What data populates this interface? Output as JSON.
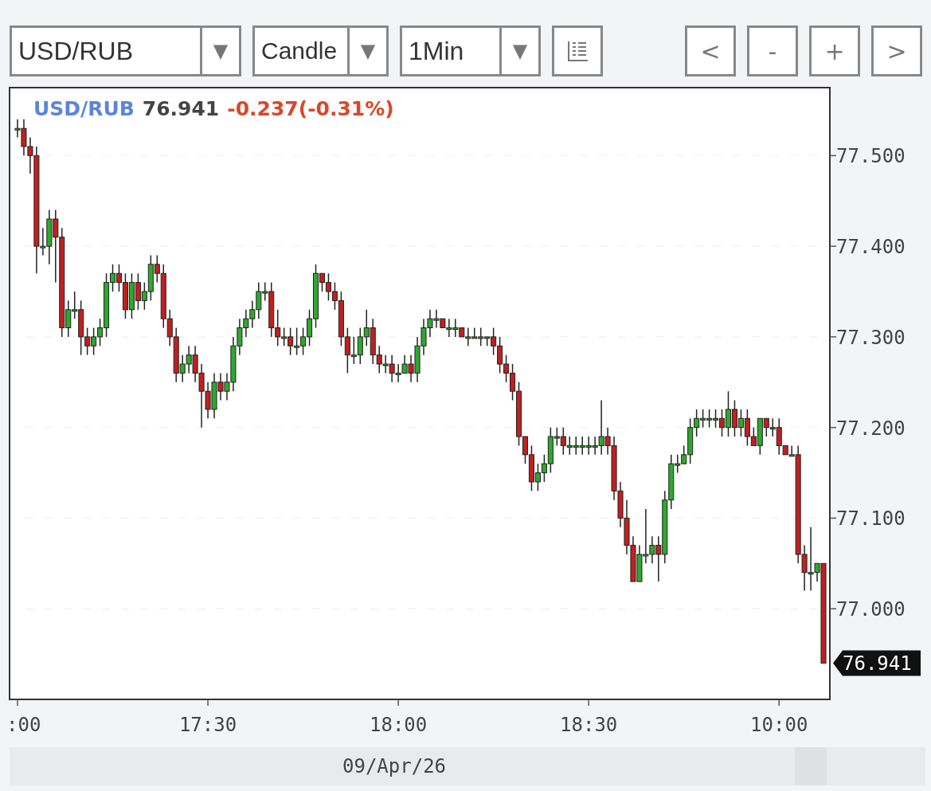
{
  "toolbar": {
    "dropdowns": [
      {
        "value": "USD/RUB",
        "arrow": "▼"
      },
      {
        "value": "Candle",
        "arrow": "▼"
      },
      {
        "value": "1Min",
        "arrow": "▼"
      }
    ],
    "nav_buttons": [
      "<",
      "-",
      "+",
      ">"
    ]
  },
  "legend": {
    "symbol": "USD/RUB",
    "price": "76.941",
    "change": "-0.237(-0.31%)"
  },
  "chart": {
    "chart_data": {
      "type": "candlestick",
      "xlabel": "09/Apr/26",
      "ylim": [
        76.9,
        77.575
      ],
      "grid": true,
      "categories": [
        ":00",
        null,
        null,
        null,
        null,
        null,
        null,
        null,
        null,
        null,
        null,
        null,
        null,
        null,
        null,
        null,
        null,
        null,
        null,
        null,
        null,
        null,
        null,
        null,
        null,
        null,
        null,
        null,
        null,
        null,
        "17:30",
        null,
        null,
        null,
        null,
        null,
        null,
        null,
        null,
        null,
        null,
        null,
        null,
        null,
        null,
        null,
        null,
        null,
        null,
        null,
        null,
        null,
        null,
        null,
        null,
        null,
        null,
        null,
        null,
        null,
        "18:00",
        null,
        null,
        null,
        null,
        null,
        null,
        null,
        null,
        null,
        null,
        null,
        null,
        null,
        null,
        null,
        null,
        null,
        null,
        null,
        null,
        null,
        null,
        null,
        null,
        null,
        null,
        null,
        null,
        null,
        "18:30",
        null,
        null,
        null,
        null,
        null,
        null,
        null,
        null,
        null,
        null,
        null,
        null,
        null,
        null,
        null,
        null,
        null,
        null,
        null,
        null,
        null,
        null,
        null,
        null,
        null,
        null,
        null,
        null,
        null,
        "10:00",
        null,
        null,
        null,
        null,
        null,
        null,
        null
      ],
      "yticks": [
        {
          "value": 77.0,
          "label": "77.000"
        },
        {
          "value": 77.1,
          "label": "77.100"
        },
        {
          "value": 77.2,
          "label": "77.200"
        },
        {
          "value": 77.3,
          "label": "77.300"
        },
        {
          "value": 77.4,
          "label": "77.400"
        },
        {
          "value": 77.5,
          "label": "77.500"
        }
      ],
      "annotations": [
        "76.941"
      ],
      "ohlc": [
        [
          77.53,
          77.54,
          77.52,
          77.53
        ],
        [
          77.53,
          77.54,
          77.5,
          77.51
        ],
        [
          77.51,
          77.52,
          77.48,
          77.5
        ],
        [
          77.5,
          77.51,
          77.37,
          77.4
        ],
        [
          77.4,
          77.42,
          77.39,
          77.4
        ],
        [
          77.4,
          77.44,
          77.38,
          77.43
        ],
        [
          77.43,
          77.44,
          77.36,
          77.41
        ],
        [
          77.41,
          77.42,
          77.3,
          77.31
        ],
        [
          77.31,
          77.34,
          77.3,
          77.33
        ],
        [
          77.33,
          77.35,
          77.32,
          77.33
        ],
        [
          77.33,
          77.34,
          77.28,
          77.3
        ],
        [
          77.3,
          77.31,
          77.28,
          77.29
        ],
        [
          77.29,
          77.31,
          77.28,
          77.3
        ],
        [
          77.3,
          77.32,
          77.29,
          77.31
        ],
        [
          77.31,
          77.37,
          77.3,
          77.36
        ],
        [
          77.36,
          77.38,
          77.35,
          77.37
        ],
        [
          77.37,
          77.38,
          77.35,
          77.36
        ],
        [
          77.36,
          77.37,
          77.32,
          77.33
        ],
        [
          77.33,
          77.37,
          77.32,
          77.36
        ],
        [
          77.36,
          77.37,
          77.33,
          77.34
        ],
        [
          77.34,
          77.36,
          77.33,
          77.35
        ],
        [
          77.35,
          77.39,
          77.34,
          77.38
        ],
        [
          77.38,
          77.39,
          77.36,
          77.37
        ],
        [
          77.37,
          77.38,
          77.31,
          77.32
        ],
        [
          77.32,
          77.33,
          77.29,
          77.3
        ],
        [
          77.3,
          77.31,
          77.25,
          77.26
        ],
        [
          77.26,
          77.28,
          77.25,
          77.27
        ],
        [
          77.27,
          77.29,
          77.26,
          77.28
        ],
        [
          77.28,
          77.29,
          77.25,
          77.26
        ],
        [
          77.26,
          77.27,
          77.2,
          77.24
        ],
        [
          77.24,
          77.25,
          77.21,
          77.22
        ],
        [
          77.22,
          77.26,
          77.21,
          77.25
        ],
        [
          77.25,
          77.26,
          77.23,
          77.24
        ],
        [
          77.24,
          77.26,
          77.23,
          77.25
        ],
        [
          77.25,
          77.3,
          77.24,
          77.29
        ],
        [
          77.29,
          77.32,
          77.28,
          77.31
        ],
        [
          77.31,
          77.33,
          77.3,
          77.32
        ],
        [
          77.32,
          77.34,
          77.31,
          77.33
        ],
        [
          77.33,
          77.36,
          77.32,
          77.35
        ],
        [
          77.35,
          77.36,
          77.34,
          77.35
        ],
        [
          77.35,
          77.36,
          77.3,
          77.31
        ],
        [
          77.31,
          77.33,
          77.29,
          77.3
        ],
        [
          77.3,
          77.31,
          77.29,
          77.3
        ],
        [
          77.3,
          77.31,
          77.28,
          77.29
        ],
        [
          77.29,
          77.31,
          77.28,
          77.29
        ],
        [
          77.29,
          77.31,
          77.28,
          77.3
        ],
        [
          77.3,
          77.33,
          77.29,
          77.32
        ],
        [
          77.32,
          77.38,
          77.31,
          77.37
        ],
        [
          77.37,
          77.37,
          77.35,
          77.36
        ],
        [
          77.36,
          77.37,
          77.34,
          77.35
        ],
        [
          77.35,
          77.36,
          77.33,
          77.34
        ],
        [
          77.34,
          77.35,
          77.29,
          77.3
        ],
        [
          77.3,
          77.31,
          77.26,
          77.28
        ],
        [
          77.28,
          77.3,
          77.27,
          77.28
        ],
        [
          77.28,
          77.31,
          77.27,
          77.3
        ],
        [
          77.3,
          77.33,
          77.29,
          77.31
        ],
        [
          77.31,
          77.32,
          77.27,
          77.28
        ],
        [
          77.28,
          77.29,
          77.26,
          77.27
        ],
        [
          77.27,
          77.28,
          77.26,
          77.27
        ],
        [
          77.27,
          77.28,
          77.25,
          77.26
        ],
        [
          77.26,
          77.27,
          77.25,
          77.26
        ],
        [
          77.26,
          77.28,
          77.26,
          77.27
        ],
        [
          77.27,
          77.28,
          77.25,
          77.26
        ],
        [
          77.26,
          77.3,
          77.25,
          77.29
        ],
        [
          77.29,
          77.32,
          77.28,
          77.31
        ],
        [
          77.31,
          77.33,
          77.3,
          77.32
        ],
        [
          77.32,
          77.33,
          77.31,
          77.32
        ],
        [
          77.32,
          77.32,
          77.31,
          77.31
        ],
        [
          77.31,
          77.32,
          77.3,
          77.31
        ],
        [
          77.31,
          77.32,
          77.3,
          77.31
        ],
        [
          77.31,
          77.31,
          77.3,
          77.3
        ],
        [
          77.3,
          77.31,
          77.29,
          77.3
        ],
        [
          77.3,
          77.31,
          77.3,
          77.3
        ],
        [
          77.3,
          77.31,
          77.29,
          77.3
        ],
        [
          77.3,
          77.3,
          77.29,
          77.3
        ],
        [
          77.3,
          77.31,
          77.28,
          77.29
        ],
        [
          77.29,
          77.3,
          77.26,
          77.27
        ],
        [
          77.27,
          77.28,
          77.25,
          77.26
        ],
        [
          77.26,
          77.27,
          77.23,
          77.24
        ],
        [
          77.24,
          77.25,
          77.18,
          77.19
        ],
        [
          77.19,
          77.19,
          77.16,
          77.17
        ],
        [
          77.17,
          77.18,
          77.13,
          77.14
        ],
        [
          77.14,
          77.16,
          77.13,
          77.15
        ],
        [
          77.15,
          77.17,
          77.14,
          77.16
        ],
        [
          77.16,
          77.2,
          77.15,
          77.19
        ],
        [
          77.19,
          77.2,
          77.18,
          77.19
        ],
        [
          77.19,
          77.2,
          77.17,
          77.18
        ],
        [
          77.18,
          77.19,
          77.17,
          77.18
        ],
        [
          77.18,
          77.19,
          77.17,
          77.18
        ],
        [
          77.18,
          77.19,
          77.17,
          77.18
        ],
        [
          77.18,
          77.19,
          77.17,
          77.18
        ],
        [
          77.18,
          77.19,
          77.17,
          77.18
        ],
        [
          77.18,
          77.23,
          77.17,
          77.19
        ],
        [
          77.19,
          77.2,
          77.17,
          77.18
        ],
        [
          77.18,
          77.19,
          77.12,
          77.13
        ],
        [
          77.13,
          77.14,
          77.09,
          77.1
        ],
        [
          77.1,
          77.12,
          77.06,
          77.07
        ],
        [
          77.07,
          77.08,
          77.03,
          77.03
        ],
        [
          77.03,
          77.07,
          77.03,
          77.06
        ],
        [
          77.06,
          77.11,
          77.05,
          77.06
        ],
        [
          77.06,
          77.08,
          77.05,
          77.07
        ],
        [
          77.07,
          77.08,
          77.03,
          77.06
        ],
        [
          77.06,
          77.13,
          77.05,
          77.12
        ],
        [
          77.12,
          77.17,
          77.11,
          77.16
        ],
        [
          77.16,
          77.17,
          77.15,
          77.16
        ],
        [
          77.16,
          77.18,
          77.16,
          77.17
        ],
        [
          77.17,
          77.21,
          77.16,
          77.2
        ],
        [
          77.2,
          77.22,
          77.19,
          77.21
        ],
        [
          77.21,
          77.22,
          77.2,
          77.21
        ],
        [
          77.21,
          77.22,
          77.2,
          77.21
        ],
        [
          77.21,
          77.22,
          77.2,
          77.21
        ],
        [
          77.21,
          77.22,
          77.19,
          77.2
        ],
        [
          77.2,
          77.24,
          77.19,
          77.22
        ],
        [
          77.22,
          77.23,
          77.19,
          77.2
        ],
        [
          77.2,
          77.22,
          77.19,
          77.21
        ],
        [
          77.21,
          77.22,
          77.18,
          77.19
        ],
        [
          77.19,
          77.2,
          77.18,
          77.18
        ],
        [
          77.18,
          77.21,
          77.17,
          77.21
        ],
        [
          77.21,
          77.21,
          77.19,
          77.2
        ],
        [
          77.2,
          77.21,
          77.19,
          77.2
        ],
        [
          77.2,
          77.21,
          77.17,
          77.18
        ],
        [
          77.18,
          77.18,
          77.17,
          77.17
        ],
        [
          77.17,
          77.18,
          77.17,
          77.17
        ],
        [
          77.17,
          77.18,
          77.05,
          77.06
        ],
        [
          77.06,
          77.07,
          77.02,
          77.04
        ],
        [
          77.04,
          77.09,
          77.02,
          77.04
        ],
        [
          77.04,
          77.05,
          77.03,
          77.05
        ],
        [
          77.05,
          77.05,
          76.94,
          76.94
        ]
      ]
    }
  }
}
